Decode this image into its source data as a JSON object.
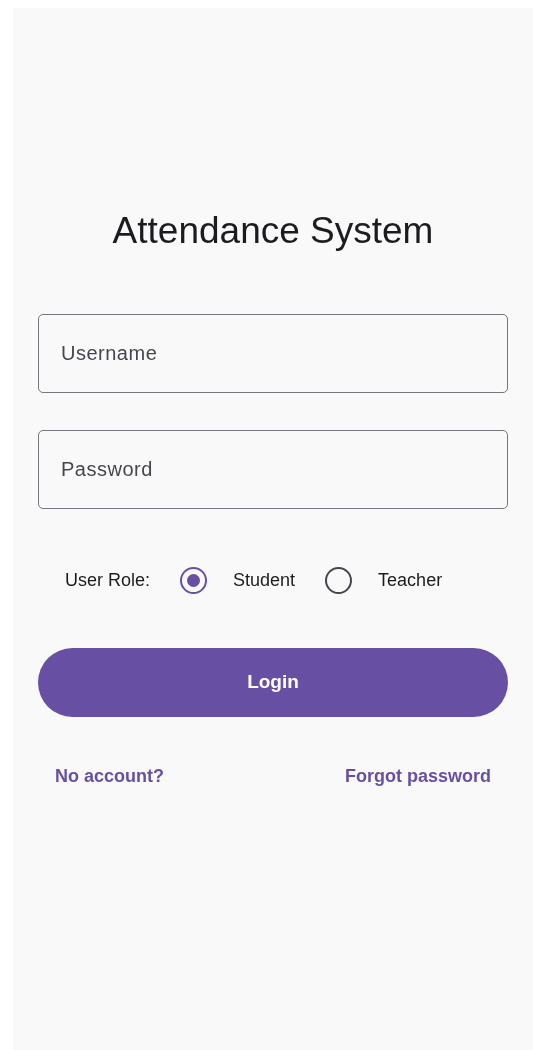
{
  "title": "Attendance System",
  "fields": [
    {
      "placeholder": "Username"
    },
    {
      "placeholder": "Password"
    }
  ],
  "role": {
    "label": "User Role:",
    "options": [
      {
        "label": "Student",
        "selected": true
      },
      {
        "label": "Teacher",
        "selected": false
      }
    ]
  },
  "login_button": "Login",
  "links": [
    "No account?",
    "Forgot password"
  ]
}
